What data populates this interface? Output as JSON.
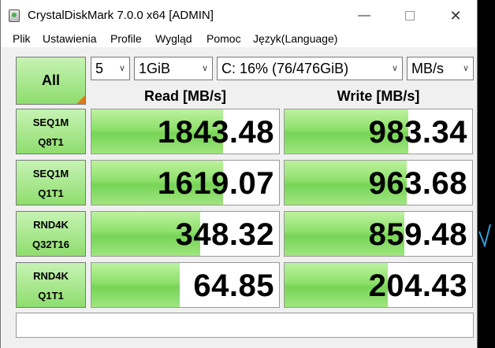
{
  "window": {
    "title": "CrystalDiskMark 7.0.0 x64 [ADMIN]",
    "min_glyph": "—",
    "close_glyph": "✕",
    "icon": "crystaldiskmark-app-icon"
  },
  "menu": [
    "Plik",
    "Ustawienia",
    "Profile",
    "Wygląd",
    "Pomoc",
    "Język(Language)"
  ],
  "controls": {
    "all_label": "All",
    "count": "5",
    "size": "1GiB",
    "drive": "C: 16% (76/476GiB)",
    "unit": "MB/s"
  },
  "headers": {
    "read": "Read [MB/s]",
    "write": "Write [MB/s]"
  },
  "tests": [
    {
      "line1": "SEQ1M",
      "line2": "Q8T1",
      "read": "1843.48",
      "write": "983.34",
      "read_fill": 0.7,
      "write_fill": 0.66
    },
    {
      "line1": "SEQ1M",
      "line2": "Q1T1",
      "read": "1619.07",
      "write": "963.68",
      "read_fill": 0.7,
      "write_fill": 0.65
    },
    {
      "line1": "RND4K",
      "line2": "Q32T16",
      "read": "348.32",
      "write": "859.48",
      "read_fill": 0.58,
      "write_fill": 0.64
    },
    {
      "line1": "RND4K",
      "line2": "Q1T1",
      "read": "64.85",
      "write": "204.43",
      "read_fill": 0.47,
      "write_fill": 0.55
    }
  ],
  "status_text": "",
  "colors": {
    "bar_green": "#8ee06a",
    "button_green": "#a8e68c",
    "corner_orange": "#e07a1c"
  }
}
